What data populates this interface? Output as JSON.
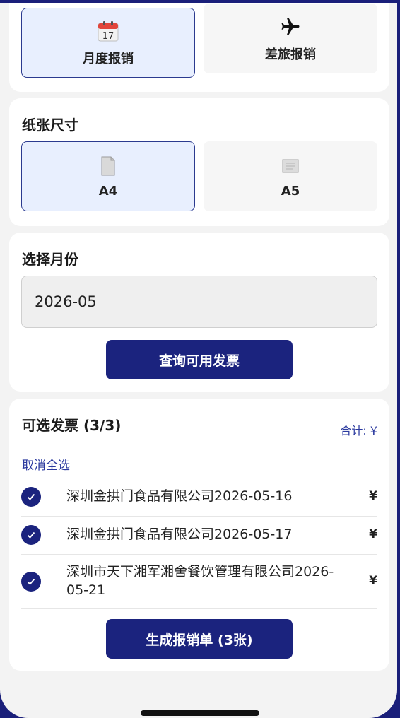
{
  "report_type": {
    "options": [
      {
        "label": "月度报销",
        "icon": "calendar-icon",
        "selected": true
      },
      {
        "label": "差旅报销",
        "icon": "airplane-icon",
        "selected": false
      }
    ]
  },
  "paper": {
    "title": "纸张尺寸",
    "options": [
      {
        "label": "A4",
        "icon": "paper-a4-icon",
        "selected": true
      },
      {
        "label": "A5",
        "icon": "paper-a5-icon",
        "selected": false
      }
    ]
  },
  "month": {
    "title": "选择月份",
    "value": "2026-05",
    "query_button": "查询可用发票"
  },
  "invoices": {
    "header": "可选发票 (3/3)",
    "total_label": "合计: ¥",
    "deselect_all": "取消全选",
    "items": [
      {
        "name": "深圳金拱门食品有限公司2026-05-16",
        "amount": "¥",
        "checked": true
      },
      {
        "name": "深圳金拱门食品有限公司2026-05-17",
        "amount": "¥",
        "checked": true
      },
      {
        "name": "深圳市天下湘军湘舍餐饮管理有限公司2026-05-21",
        "amount": "¥",
        "checked": true
      }
    ],
    "generate_button": "生成报销单 (3张)"
  },
  "colors": {
    "primary": "#1b237e",
    "selected_bg": "#e8effe",
    "link": "#2b3a9f"
  }
}
